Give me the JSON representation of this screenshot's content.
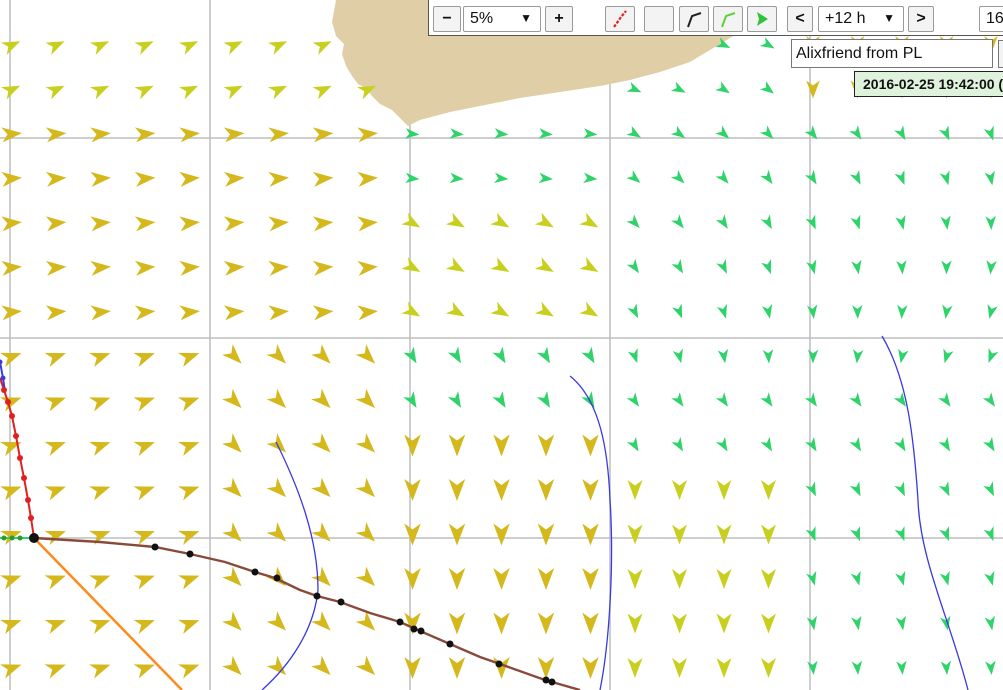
{
  "toolbar": {
    "zoom_out_label": "−",
    "opacity_value": "5%",
    "zoom_in_label": "+",
    "prev_label": "<",
    "time_step": "+12 h",
    "next_label": ">",
    "extra_value": "16"
  },
  "boat_field": {
    "value": "Alixfriend from PL"
  },
  "timestamp": "2016-02-25 19:42:00 (",
  "colors": {
    "land": "#e0cfa6",
    "grid": "#bdbdbd",
    "wind_strong": "#d4b81c",
    "wind_medium": "#c8cf1e",
    "wind_light": "#2ed36a",
    "route_red": "#e02020",
    "route_orange": "#ff8a1c",
    "isochrone_blue": "#3a3ae0",
    "track_brown": "#8a4a3a"
  },
  "icons": [
    "route-red-icon",
    "blank-toggle-icon",
    "route-line-icon",
    "route-green-icon",
    "wind-arrow-icon",
    "caret-down-icon"
  ]
}
